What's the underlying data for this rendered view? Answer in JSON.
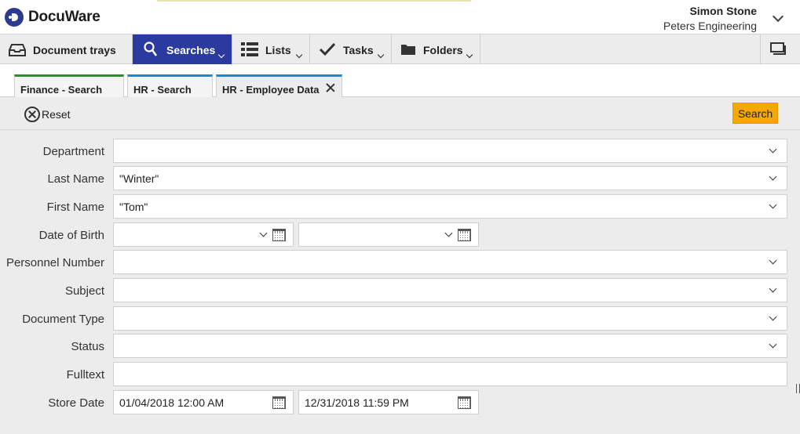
{
  "app": {
    "name": "DocuWare"
  },
  "user": {
    "name": "Simon Stone",
    "company": "Peters Engineering"
  },
  "nav": {
    "items": [
      {
        "label": "Document trays",
        "icon": "tray-icon"
      },
      {
        "label": "Searches",
        "icon": "search-icon",
        "active": true
      },
      {
        "label": "Lists",
        "icon": "list-icon"
      },
      {
        "label": "Tasks",
        "icon": "check-icon"
      },
      {
        "label": "Folders",
        "icon": "folder-icon"
      }
    ]
  },
  "tabs": [
    {
      "label": "Finance - Search",
      "accent": "#2e8b2e"
    },
    {
      "label": "HR - Search",
      "accent": "#1c88d4"
    },
    {
      "label": "HR - Employee Data",
      "accent": "#1c88d4",
      "active": true
    }
  ],
  "toolbar": {
    "reset_label": "Reset",
    "search_label": "Search"
  },
  "form": {
    "fields": [
      {
        "label": "Department",
        "value": "",
        "type": "select"
      },
      {
        "label": "Last Name",
        "value": "\"Winter\"",
        "type": "select"
      },
      {
        "label": "First Name",
        "value": "\"Tom\"",
        "type": "select"
      },
      {
        "label": "Date of Birth",
        "from": "",
        "to": "",
        "type": "date-range"
      },
      {
        "label": "Personnel Number",
        "value": "",
        "type": "select"
      },
      {
        "label": "Subject",
        "value": "",
        "type": "select"
      },
      {
        "label": "Document Type",
        "value": "",
        "type": "select"
      },
      {
        "label": "Status",
        "value": "",
        "type": "select"
      },
      {
        "label": "Fulltext",
        "value": "",
        "type": "text"
      },
      {
        "label": "Store Date",
        "from": "01/04/2018 12:00 AM",
        "to": "12/31/2018 11:59 PM",
        "type": "datetime-range"
      }
    ]
  },
  "colors": {
    "accent_blue": "#2b3a9e",
    "search_button": "#f5a800",
    "tab_green": "#2e8b2e",
    "tab_blue": "#1c88d4"
  }
}
